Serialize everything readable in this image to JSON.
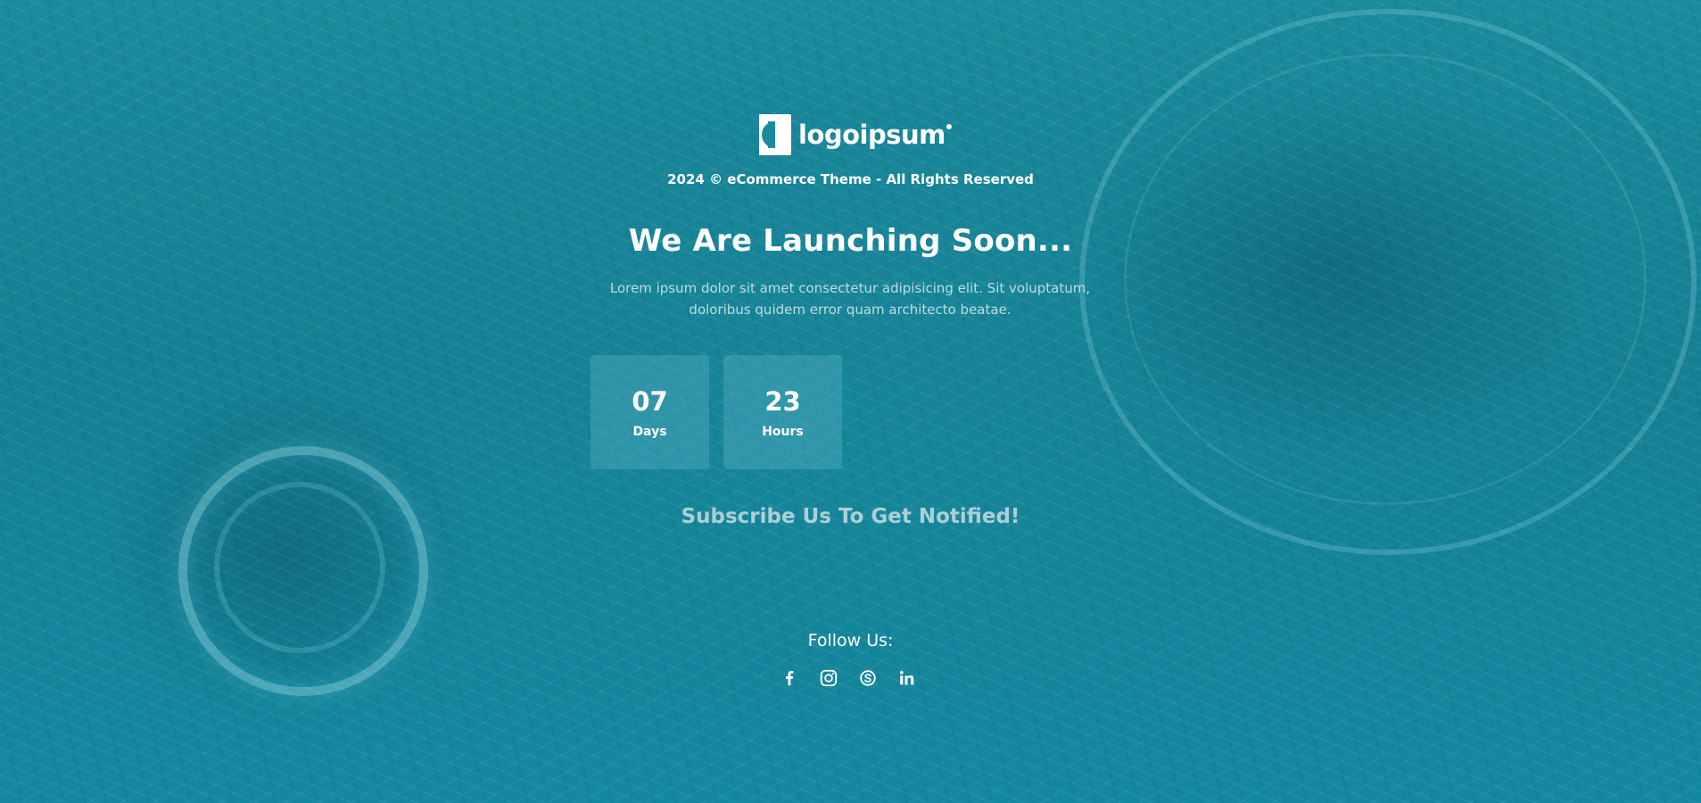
{
  "brand": {
    "logo_text": "logoipsum"
  },
  "copyright": "2024 © eCommerce Theme - All Rights Reserved",
  "headline": "We Are Launching Soon...",
  "description": "Lorem ipsum dolor sit amet consectetur adipisicing elit. Sit voluptatum, doloribus quidem error quam architecto beatae.",
  "countdown": [
    {
      "value": "07",
      "label": "Days"
    },
    {
      "value": "23",
      "label": "Hours"
    }
  ],
  "subscribe_heading": "Subscribe Us To Get Notified!",
  "follow_label": "Follow Us:",
  "social": [
    {
      "icon": "facebook-icon"
    },
    {
      "icon": "instagram-icon"
    },
    {
      "icon": "skype-icon"
    },
    {
      "icon": "linkedin-icon"
    }
  ],
  "colors": {
    "background": "#1a8a9c",
    "text": "#ffffff",
    "count_box": "#50aabe"
  }
}
